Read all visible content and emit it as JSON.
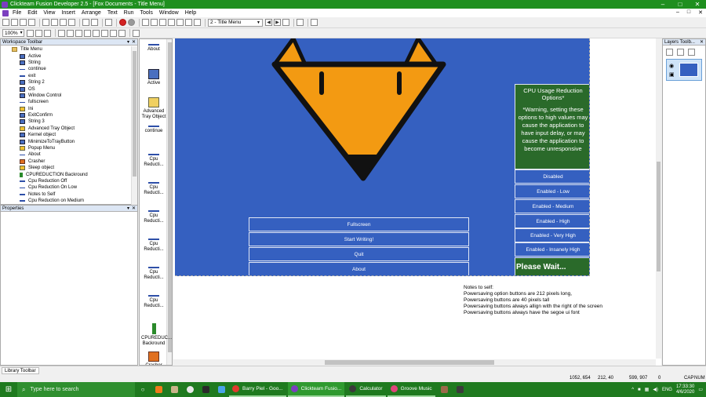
{
  "window": {
    "title": "Clickteam Fusion Developer 2.5 - [Fox Documents - Title Menu]",
    "controls": [
      "–",
      "□",
      "✕"
    ]
  },
  "menu": {
    "items": [
      "File",
      "Edit",
      "View",
      "Insert",
      "Arrange",
      "Text",
      "Run",
      "Tools",
      "Window",
      "Help"
    ],
    "mdi_controls": [
      "–",
      "□",
      "✕"
    ]
  },
  "toolbar": {
    "frame_select": "2 - Title Menu",
    "zoom": "100%"
  },
  "workspace": {
    "title": "Workspace Toolbar",
    "root": "Title Menu",
    "items": [
      {
        "label": "Active",
        "icon": "box"
      },
      {
        "label": "String",
        "icon": "box"
      },
      {
        "label": "continue",
        "icon": "line"
      },
      {
        "label": "exit",
        "icon": "line"
      },
      {
        "label": "String 2",
        "icon": "box"
      },
      {
        "label": "OS",
        "icon": "box"
      },
      {
        "label": "Window Control",
        "icon": "box"
      },
      {
        "label": "fullscreen",
        "icon": "line"
      },
      {
        "label": "Ini",
        "icon": "yellow"
      },
      {
        "label": "ExitConfirm",
        "icon": "box"
      },
      {
        "label": "String 3",
        "icon": "box"
      },
      {
        "label": "Advanced Tray Object",
        "icon": "yellow"
      },
      {
        "label": "Kernel object",
        "icon": "box"
      },
      {
        "label": "MinimizeToTrayButton",
        "icon": "box"
      },
      {
        "label": "Popup Menu",
        "icon": "yellow"
      },
      {
        "label": "About",
        "icon": "line"
      },
      {
        "label": "Crasher",
        "icon": "orange"
      },
      {
        "label": "Sleep object",
        "icon": "yellow"
      },
      {
        "label": "CPUREDUCTION Backround",
        "icon": "green"
      },
      {
        "label": "Cpu Reduction Off",
        "icon": "line"
      },
      {
        "label": "Cpu Reduction On Low",
        "icon": "line"
      },
      {
        "label": "Notes to Self",
        "icon": "line"
      },
      {
        "label": "Cpu Reduction on Medium",
        "icon": "line"
      }
    ]
  },
  "properties": {
    "title": "Properties"
  },
  "library": {
    "items": [
      {
        "label": "About",
        "icon": "line"
      },
      {
        "label": "Active",
        "icon": "box"
      },
      {
        "label": "Advanced Tray Object",
        "icon": "yellow"
      },
      {
        "label": "continue",
        "icon": "line"
      },
      {
        "label": "Cpu Reducti...",
        "icon": "line"
      },
      {
        "label": "Cpu Reducti...",
        "icon": "line"
      },
      {
        "label": "Cpu Reducti...",
        "icon": "line"
      },
      {
        "label": "Cpu Reducti...",
        "icon": "line"
      },
      {
        "label": "Cpu Reducti...",
        "icon": "line"
      },
      {
        "label": "Cpu Reducti...",
        "icon": "line"
      },
      {
        "label": "CPUREDUC... Backround",
        "icon": "green"
      },
      {
        "label": "Crasher",
        "icon": "orange"
      }
    ]
  },
  "frame": {
    "menu_buttons": [
      "Fullscreen",
      "Start Writing!",
      "Quit",
      "About"
    ],
    "cpu_panel_title": "CPU Usage Reduction Options*",
    "cpu_panel_warning": "*Warning, setting these options to high values may cause the application to have input delay, or may cause the application to become unresponsive",
    "power_buttons": [
      "Disabled",
      "Enabled - Low",
      "Enabled - Medium",
      "Enabled - High",
      "Enabled - Very High",
      "Enabled - Insanely High"
    ],
    "please_wait": "Please Wait...",
    "notes": [
      "Notes to self:",
      "Powersaving option buttons are 212 pixels long,",
      "Powersaving buttons are 40 pixels tall",
      "Powersaving buttons always allign with the right of the screen",
      "Powersaving buttons always have the segoe ui font"
    ]
  },
  "layers": {
    "title": "Layers Toolb..."
  },
  "library_tab": "Library Toolbar",
  "status": {
    "coords1": "1052, 654",
    "coords2": "212, 40",
    "coords3": "599, 907",
    "count": "0",
    "caps": "CAP",
    "num": "NUM"
  },
  "taskbar": {
    "search_placeholder": "Type here to search",
    "windows": [
      {
        "label": "Barry Piel - Goo...",
        "color": "#e23a2e",
        "active": false
      },
      {
        "label": "Clickteam Fusio...",
        "color": "#7b3fbf",
        "active": true
      },
      {
        "label": "Calculator",
        "color": "#3a3a3a",
        "active": false
      },
      {
        "label": "Groove Music",
        "color": "#e0457b",
        "active": false
      }
    ],
    "lang": "ENG",
    "time": "17:33:30",
    "date": "4/6/2020"
  },
  "colors": {
    "frame_bg": "#3560c0",
    "panel_green": "#2a6a2a",
    "fox_orange": "#f39a12",
    "titlebar": "#1f8f1f"
  }
}
